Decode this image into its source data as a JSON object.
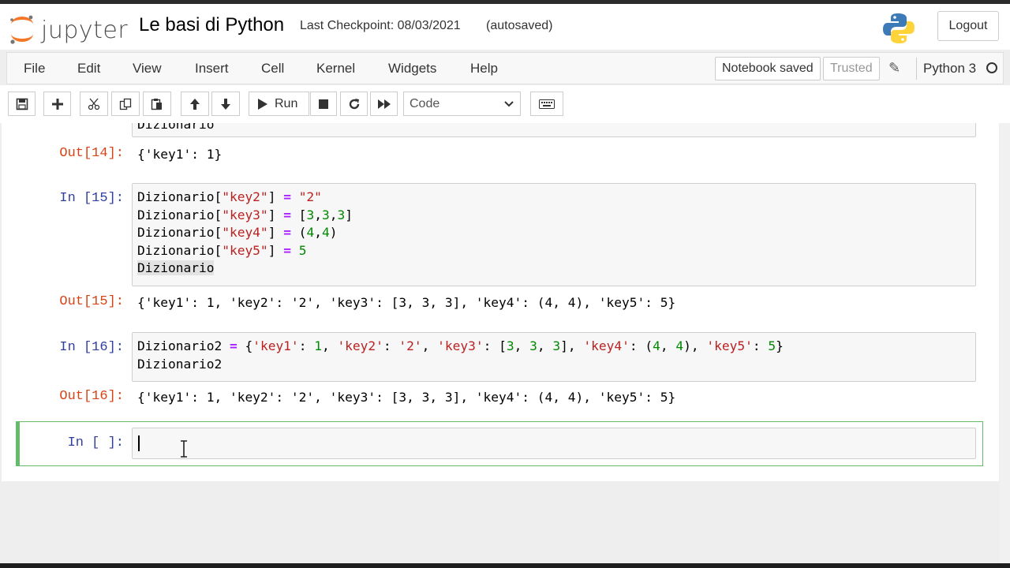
{
  "header": {
    "logo_text": "jupyter",
    "notebook_title": "Le basi di Python",
    "checkpoint": "Last Checkpoint: 08/03/2021",
    "autosave_status": "(autosaved)",
    "logout_label": "Logout"
  },
  "menu": {
    "items": [
      "File",
      "Edit",
      "View",
      "Insert",
      "Cell",
      "Kernel",
      "Widgets",
      "Help"
    ],
    "notebook_saved": "Notebook saved",
    "trusted": "Trusted",
    "kernel_name": "Python 3"
  },
  "toolbar": {
    "run_label": "Run",
    "cell_type": "Code",
    "icons": [
      "save-icon",
      "plus-icon",
      "cut-icon",
      "copy-icon",
      "paste-icon",
      "arrow-up-icon",
      "arrow-down-icon",
      "play-icon",
      "stop-icon",
      "restart-icon",
      "fast-forward-icon",
      "chevron-down-icon",
      "keyboard-icon"
    ]
  },
  "cells": {
    "partial_input": "Dizionario",
    "out14": {
      "prompt": "Out[14]:",
      "text": "{'key1': 1}"
    },
    "in15": {
      "prompt": "In [15]:",
      "lines": [
        "Dizionario[\"key2\"] = \"2\"",
        "Dizionario[\"key3\"] = [3,3,3]",
        "Dizionario[\"key4\"] = (4,4)",
        "Dizionario[\"key5\"] = 5",
        "Dizionario"
      ]
    },
    "out15": {
      "prompt": "Out[15]:",
      "text": "{'key1': 1, 'key2': '2', 'key3': [3, 3, 3], 'key4': (4, 4), 'key5': 5}"
    },
    "in16": {
      "prompt": "In [16]:",
      "lines": [
        "Dizionario2 = {'key1': 1, 'key2': '2', 'key3': [3, 3, 3], 'key4': (4, 4), 'key5': 5}",
        "Dizionario2"
      ]
    },
    "out16": {
      "prompt": "Out[16]:",
      "text": "{'key1': 1, 'key2': '2', 'key3': [3, 3, 3], 'key4': (4, 4), 'key5': 5}"
    },
    "empty": {
      "prompt": "In [ ]:",
      "content": ""
    }
  },
  "colors": {
    "in_prompt": "#303f9f",
    "out_prompt": "#d84315",
    "string": "#ba2121",
    "number": "#008800",
    "operator": "#aa22ff",
    "selected_border": "#66bb6a"
  }
}
